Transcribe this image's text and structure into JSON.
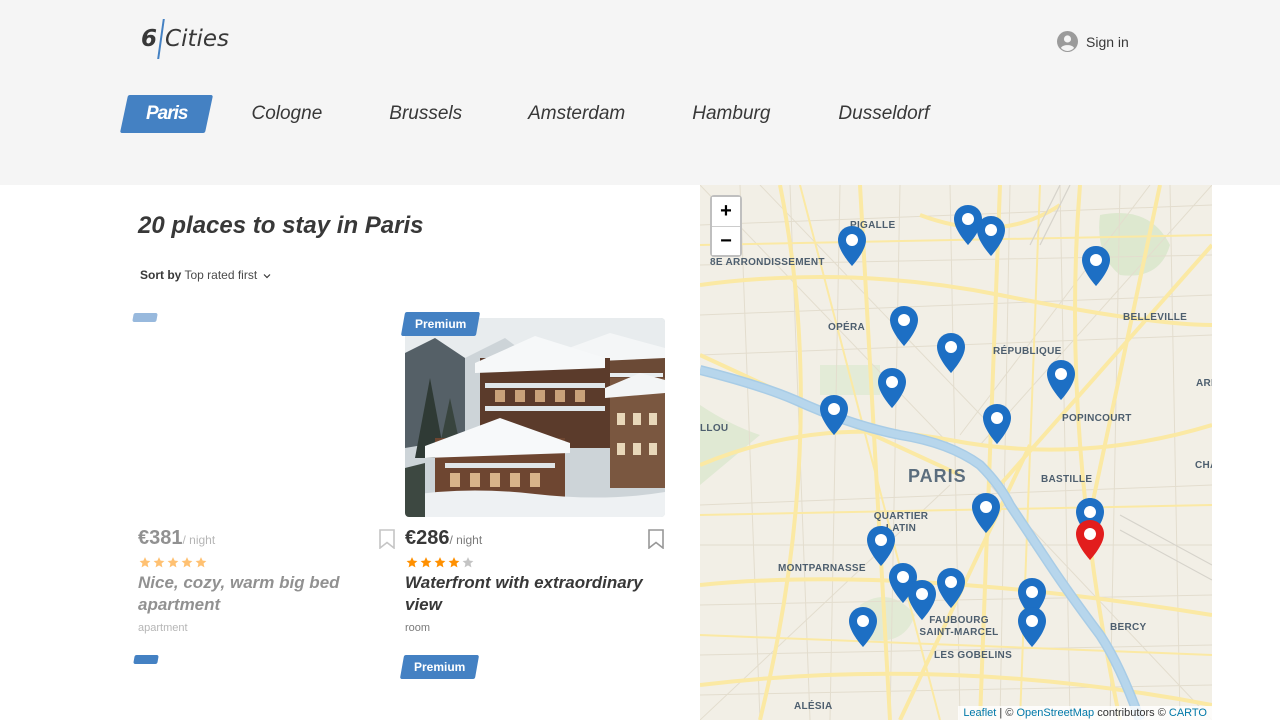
{
  "header": {
    "logo": {
      "number": "6",
      "word": "Cities"
    },
    "signin_label": "Sign in",
    "colors": {
      "accent": "#4481c3",
      "header_bg": "#f5f5f5"
    }
  },
  "tabs": [
    {
      "label": "Paris",
      "active": true
    },
    {
      "label": "Cologne",
      "active": false
    },
    {
      "label": "Brussels",
      "active": false
    },
    {
      "label": "Amsterdam",
      "active": false
    },
    {
      "label": "Hamburg",
      "active": false
    },
    {
      "label": "Dusseldorf",
      "active": false
    }
  ],
  "places": {
    "title": "20 places to stay in Paris",
    "sort_label": "Sort by",
    "sort_value": "Top rated first"
  },
  "cards": [
    {
      "premium": false,
      "price": "€381",
      "price_unit": "/ night",
      "rating_stars": 5,
      "name": "Nice, cozy, warm big bed apartment",
      "type": "apartment",
      "image": "none"
    },
    {
      "premium": true,
      "premium_label": "Premium",
      "price": "€286",
      "price_unit": "/ night",
      "rating_stars": 4,
      "name": "Waterfront with extraordinary view",
      "type": "room",
      "image": "snowy-alpine-chalet"
    }
  ],
  "next_row": {
    "premium_label": "Premium"
  },
  "map": {
    "zoom_in": "+",
    "zoom_out": "−",
    "attribution": {
      "leaflet": "Leaflet",
      "sep": " | © ",
      "osm": "OpenStreetMap",
      "contrib": " contributors © ",
      "carto": "CARTO"
    },
    "labels": [
      "PIGALLE",
      "8E ARRONDISSEMENT",
      "BELLEVILLE",
      "OPÉRA",
      "RÉPUBLIQUE",
      "ARRO",
      "LLOU",
      "POPINCOURT",
      "PARIS",
      "BASTILLE",
      "CHA",
      "QUARTIER LATIN",
      "MONTPARNASSE",
      "FAUBOURG SAINT-MARCEL",
      "BERCY",
      "LES GOBELINS",
      "ALÉSIA"
    ],
    "pin_colors": {
      "default": "#1d6fc4",
      "active": "#e21d1d"
    },
    "pin_count": 20
  }
}
